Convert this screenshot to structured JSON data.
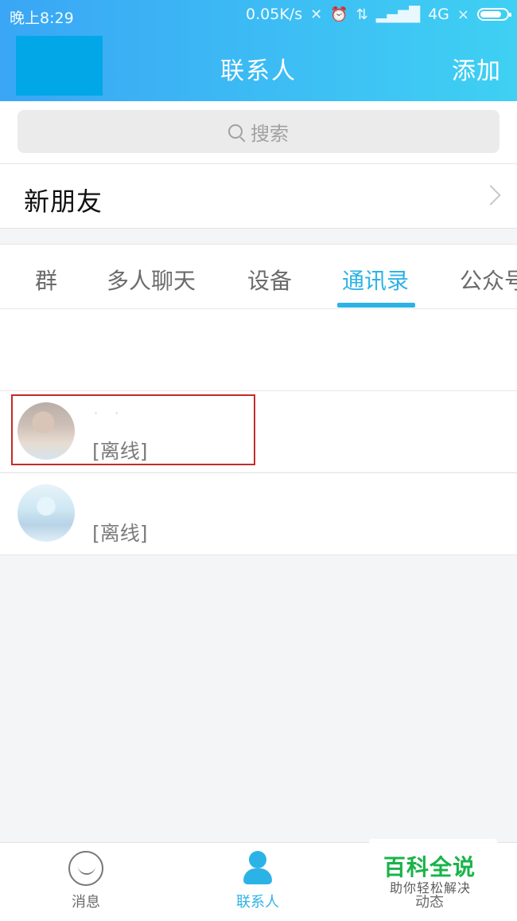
{
  "statusbar": {
    "time": "晚上8:29",
    "network_speed": "0.05K/s",
    "network_type": "4G",
    "icons": [
      "mute-icon",
      "alarm-icon",
      "data-transfer-icon",
      "signal-icon",
      "battery-icon"
    ],
    "battery_level_percent": 80
  },
  "header": {
    "title": "联系人",
    "add_label": "添加",
    "avatar_color": "#02a7e8"
  },
  "search": {
    "placeholder": "搜索",
    "icon": "search-icon"
  },
  "new_friends": {
    "label": "新朋友"
  },
  "tabs": {
    "items": [
      {
        "label": "群"
      },
      {
        "label": "多人聊天"
      },
      {
        "label": "设备"
      },
      {
        "label": "通讯录"
      },
      {
        "label": "公众号"
      }
    ],
    "active_index": 3,
    "accent_color": "#2cb3e6"
  },
  "contacts": [
    {
      "name": "· ·",
      "status": "[离线]",
      "highlighted": true
    },
    {
      "name": "",
      "status": "[离线]",
      "highlighted": false
    }
  ],
  "bottom_nav": {
    "items": [
      {
        "label": "消息",
        "icon": "smile-message-icon"
      },
      {
        "label": "联系人",
        "icon": "contacts-icon"
      },
      {
        "label": "动态",
        "icon": "star-icon"
      }
    ],
    "active_index": 1
  },
  "watermark": {
    "title": "百科全说",
    "subtitle": "助你轻松解决"
  }
}
